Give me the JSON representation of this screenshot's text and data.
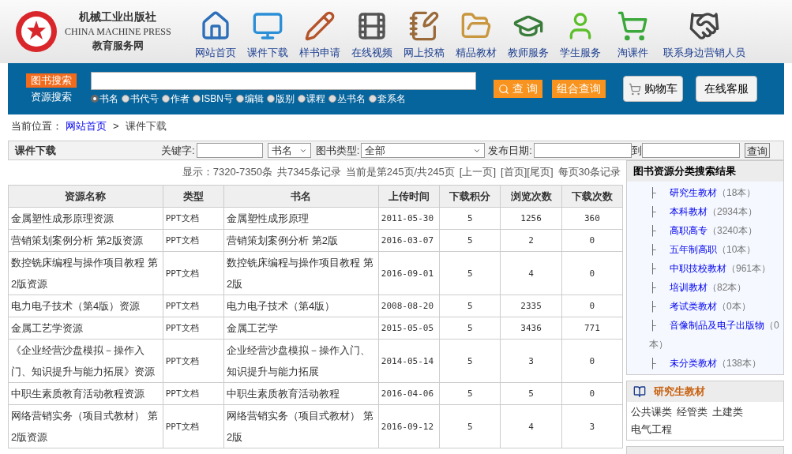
{
  "logo": {
    "name_cn": "机械工业出版社",
    "name_en": "CHINA MACHINE PRESS",
    "subtitle": "教育服务网"
  },
  "nav": [
    {
      "label": "网站首页",
      "kind": "home"
    },
    {
      "label": "课件下载",
      "kind": "monitor"
    },
    {
      "label": "样书申请",
      "kind": "pencil"
    },
    {
      "label": "在线视频",
      "kind": "film"
    },
    {
      "label": "网上投稿",
      "kind": "notebook"
    },
    {
      "label": "精品教材",
      "kind": "folder"
    },
    {
      "label": "教师服务",
      "kind": "teacher"
    },
    {
      "label": "学生服务",
      "kind": "student"
    },
    {
      "label": "淘课件",
      "kind": "cart"
    },
    {
      "label": "联系身边营销人员",
      "kind": "handshake"
    }
  ],
  "search": {
    "tabs": [
      {
        "label": "图书搜索",
        "selected": true
      },
      {
        "label": "资源搜索",
        "selected": false
      }
    ],
    "options": [
      {
        "label": "书名",
        "selected": true
      },
      {
        "label": "书代号",
        "selected": false
      },
      {
        "label": "作者",
        "selected": false
      },
      {
        "label": "ISBN号",
        "selected": false
      },
      {
        "label": "编辑",
        "selected": false
      },
      {
        "label": "版别",
        "selected": false
      },
      {
        "label": "课程",
        "selected": false
      },
      {
        "label": "丛书名",
        "selected": false
      },
      {
        "label": "套系名",
        "selected": false
      }
    ],
    "query_button": "查 询",
    "combo_button": "组合查询",
    "cart_button": "购物车",
    "service_button": "在线客服"
  },
  "breadcrumb": {
    "prefix": "当前位置：",
    "items": [
      "网站首页",
      "课件下载"
    ],
    "separator": ">"
  },
  "filter": {
    "title": "课件下载",
    "keyword_label": "关键字:",
    "field_select": "书名",
    "type_label": "图书类型:",
    "type_select": "全部",
    "date_label": "发布日期:",
    "date_to": "到",
    "query_button": "查询"
  },
  "pager": {
    "showing": "显示：7320-7350条",
    "total": "共7345条记录",
    "current": "当前是第245页/共245页",
    "prev": "[上一页]",
    "first": "[首页]",
    "last": "[尾页]",
    "per_page": "每页30条记录"
  },
  "table": {
    "columns": [
      "资源名称",
      "类型",
      "书名",
      "上传时间",
      "下载积分",
      "浏览次数",
      "下载次数"
    ],
    "rows": [
      [
        "金属塑性成形原理资源",
        "PPT文档",
        "金属塑性成形原理",
        "2011-05-30",
        "5",
        "1256",
        "360"
      ],
      [
        "营销策划案例分析 第2版资源",
        "PPT文档",
        "营销策划案例分析 第2版",
        "2016-03-07",
        "5",
        "2",
        "0"
      ],
      [
        "数控铣床编程与操作项目教程 第2版资源",
        "PPT文档",
        "数控铣床编程与操作项目教程 第2版",
        "2016-09-01",
        "5",
        "4",
        "0"
      ],
      [
        "电力电子技术（第4版）资源",
        "PPT文档",
        "电力电子技术（第4版）",
        "2008-08-20",
        "5",
        "2335",
        "0"
      ],
      [
        "金属工艺学资源",
        "PPT文档",
        "金属工艺学",
        "2015-05-05",
        "5",
        "3436",
        "771"
      ],
      [
        "《企业经营沙盘模拟－操作入门、知识提升与能力拓展》资源",
        "PPT文档",
        "企业经营沙盘模拟－操作入门、知识提升与能力拓展",
        "2014-05-14",
        "5",
        "3",
        "0"
      ],
      [
        "中职生素质教育活动教程资源",
        "PPT文档",
        "中职生素质教育活动教程",
        "2016-04-06",
        "5",
        "5",
        "0"
      ],
      [
        "网络营销实务（项目式教材） 第2版资源",
        "PPT文档",
        "网络营销实务（项目式教材） 第2版",
        "2016-09-12",
        "5",
        "4",
        "3"
      ]
    ]
  },
  "categories": {
    "title": "图书资源分类搜索结果",
    "branch": "├",
    "items": [
      {
        "name": "研究生教材",
        "count": "（18本）"
      },
      {
        "name": "本科教材",
        "count": "（2934本）"
      },
      {
        "name": "高职高专",
        "count": "（3240本）"
      },
      {
        "name": "五年制高职",
        "count": "（10本）"
      },
      {
        "name": "中职技校教材",
        "count": "（961本）"
      },
      {
        "name": "培训教材",
        "count": "（82本）"
      },
      {
        "name": "考试类教材",
        "count": "（0本）"
      },
      {
        "name": "音像制品及电子出版物",
        "count": "（0本）"
      },
      {
        "name": "未分类教材",
        "count": "（138本）"
      }
    ]
  },
  "graduate_panel": {
    "title": "研究生教材",
    "links": [
      "公共课类",
      "经管类",
      "土建类",
      "电气工程"
    ]
  }
}
